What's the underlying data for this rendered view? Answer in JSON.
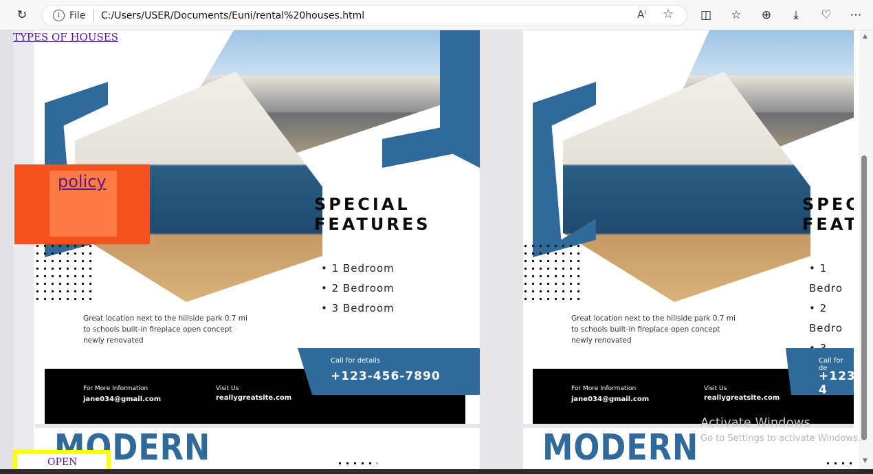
{
  "browser": {
    "refresh_icon": "refresh-icon",
    "file_label": "File",
    "url": "C:/Users/USER/Documents/Euni/rental%20houses.html"
  },
  "page": {
    "types_link": "TYPES OF HOUSES",
    "policy_link": "policy",
    "open_label": "OPEN",
    "flyer": {
      "title_line1": "SPECIAL",
      "title_line2": "FEATURES",
      "bullets": [
        "• 1 Bedroom",
        "• 2 Bedroom",
        "• 3 Bedroom"
      ],
      "description": "Great location next to the hillside park 0.7 mi to schools built-in fireplace open concept newly renovated",
      "call_label": "Call for details",
      "phone": "+123-456-7890",
      "info_label": "For More Information",
      "email": "jane034@gmail.com",
      "visit_label": "Visit Us",
      "site": "reallygreatsite.com",
      "modern": "MODERN"
    },
    "flyer_right": {
      "title_line1": "SPEC",
      "title_line2": "FEATU",
      "bullets": [
        "• 1 Bedro",
        "• 2 Bedro",
        "• 3 Bedro"
      ],
      "call_label": "Call for de",
      "phone": "+123-4"
    },
    "watermark": {
      "line1": "Activate Windows",
      "line2": "Go to Settings to activate Windows."
    }
  },
  "colors": {
    "accent_blue": "#2f6a9b",
    "policy_orange": "#f4511e",
    "policy_inner": "#ff7a45",
    "open_yellow": "#ffff00",
    "link_purple": "#551a8b"
  }
}
